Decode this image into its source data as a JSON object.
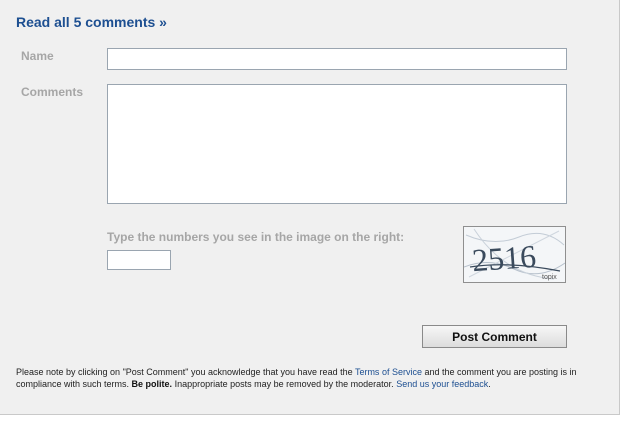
{
  "comments": {
    "read_all_link": "Read all 5 comments »"
  },
  "form": {
    "name_label": "Name",
    "name_value": "",
    "comments_label": "Comments",
    "comments_value": "",
    "captcha_prompt": "Type the numbers you see in the image on the right:",
    "captcha_value": "",
    "captcha_image_text": "2516",
    "captcha_image_brand": "topix",
    "post_button": "Post Comment"
  },
  "notice": {
    "text_1": "Please note by clicking on \"Post Comment\" you acknowledge that you have read the ",
    "tos_link": "Terms of Service",
    "text_2": " and the comment you are posting is in compliance with such terms. ",
    "polite": "Be polite.",
    "text_3": " Inappropriate posts may be removed by the moderator. ",
    "feedback_link": "Send us your feedback",
    "text_4": "."
  },
  "colors": {
    "panel_bg": "#f0f0f0",
    "link": "#1d4f91",
    "label": "#a6a6a6"
  }
}
